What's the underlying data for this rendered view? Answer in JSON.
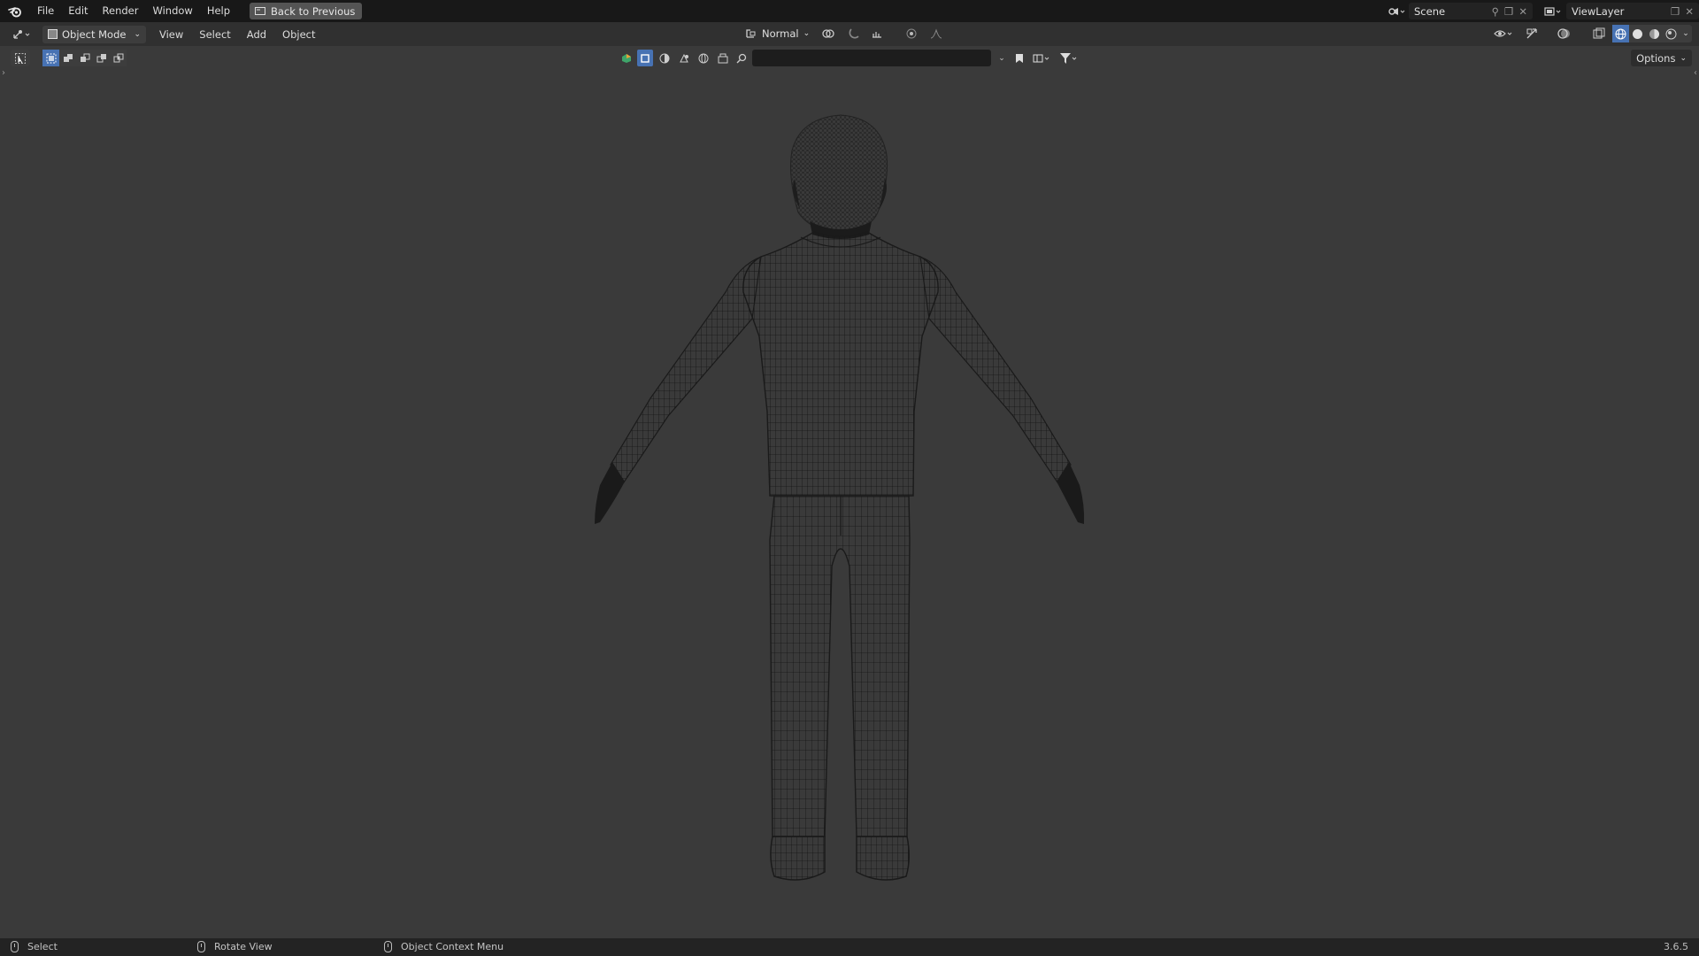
{
  "topbar": {
    "menu": [
      "File",
      "Edit",
      "Render",
      "Window",
      "Help"
    ],
    "back_button": "Back to Previous",
    "scene": "Scene",
    "view_layer": "ViewLayer"
  },
  "header": {
    "mode": "Object Mode",
    "menus": [
      "View",
      "Select",
      "Add",
      "Object"
    ],
    "transform_orientation": "Normal",
    "shading_active": "wireframe"
  },
  "toolbar": {
    "search_placeholder": "",
    "options_label": "Options"
  },
  "viewport": {
    "model": "wireframe-character-back-view"
  },
  "statusbar": {
    "items": [
      "Select",
      "Rotate View",
      "Object Context Menu"
    ],
    "version": "3.6.5"
  },
  "colors": {
    "accent": "#4772b3",
    "viewport_bg": "#3a3a3a",
    "topbar_bg": "#181818"
  }
}
